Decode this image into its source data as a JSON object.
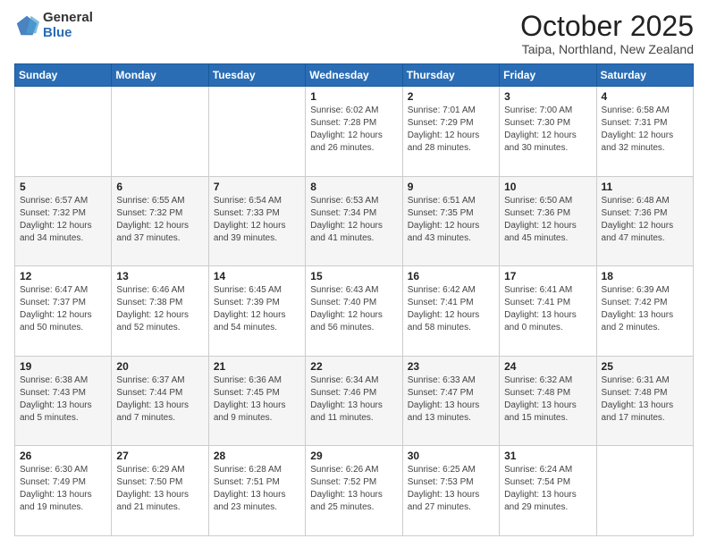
{
  "logo": {
    "general": "General",
    "blue": "Blue"
  },
  "title": {
    "month": "October 2025",
    "location": "Taipa, Northland, New Zealand"
  },
  "days_header": [
    "Sunday",
    "Monday",
    "Tuesday",
    "Wednesday",
    "Thursday",
    "Friday",
    "Saturday"
  ],
  "weeks": [
    [
      null,
      null,
      null,
      {
        "day": 1,
        "sunrise": "6:02 AM",
        "sunset": "7:28 PM",
        "daylight": "12 hours and 26 minutes."
      },
      {
        "day": 2,
        "sunrise": "7:01 AM",
        "sunset": "7:29 PM",
        "daylight": "12 hours and 28 minutes."
      },
      {
        "day": 3,
        "sunrise": "7:00 AM",
        "sunset": "7:30 PM",
        "daylight": "12 hours and 30 minutes."
      },
      {
        "day": 4,
        "sunrise": "6:58 AM",
        "sunset": "7:31 PM",
        "daylight": "12 hours and 32 minutes."
      }
    ],
    [
      {
        "day": 5,
        "sunrise": "6:57 AM",
        "sunset": "7:32 PM",
        "daylight": "12 hours and 34 minutes."
      },
      {
        "day": 6,
        "sunrise": "6:55 AM",
        "sunset": "7:32 PM",
        "daylight": "12 hours and 37 minutes."
      },
      {
        "day": 7,
        "sunrise": "6:54 AM",
        "sunset": "7:33 PM",
        "daylight": "12 hours and 39 minutes."
      },
      {
        "day": 8,
        "sunrise": "6:53 AM",
        "sunset": "7:34 PM",
        "daylight": "12 hours and 41 minutes."
      },
      {
        "day": 9,
        "sunrise": "6:51 AM",
        "sunset": "7:35 PM",
        "daylight": "12 hours and 43 minutes."
      },
      {
        "day": 10,
        "sunrise": "6:50 AM",
        "sunset": "7:36 PM",
        "daylight": "12 hours and 45 minutes."
      },
      {
        "day": 11,
        "sunrise": "6:48 AM",
        "sunset": "7:36 PM",
        "daylight": "12 hours and 47 minutes."
      }
    ],
    [
      {
        "day": 12,
        "sunrise": "6:47 AM",
        "sunset": "7:37 PM",
        "daylight": "12 hours and 50 minutes."
      },
      {
        "day": 13,
        "sunrise": "6:46 AM",
        "sunset": "7:38 PM",
        "daylight": "12 hours and 52 minutes."
      },
      {
        "day": 14,
        "sunrise": "6:45 AM",
        "sunset": "7:39 PM",
        "daylight": "12 hours and 54 minutes."
      },
      {
        "day": 15,
        "sunrise": "6:43 AM",
        "sunset": "7:40 PM",
        "daylight": "12 hours and 56 minutes."
      },
      {
        "day": 16,
        "sunrise": "6:42 AM",
        "sunset": "7:41 PM",
        "daylight": "12 hours and 58 minutes."
      },
      {
        "day": 17,
        "sunrise": "6:41 AM",
        "sunset": "7:41 PM",
        "daylight": "13 hours and 0 minutes."
      },
      {
        "day": 18,
        "sunrise": "6:39 AM",
        "sunset": "7:42 PM",
        "daylight": "13 hours and 2 minutes."
      }
    ],
    [
      {
        "day": 19,
        "sunrise": "6:38 AM",
        "sunset": "7:43 PM",
        "daylight": "13 hours and 5 minutes."
      },
      {
        "day": 20,
        "sunrise": "6:37 AM",
        "sunset": "7:44 PM",
        "daylight": "13 hours and 7 minutes."
      },
      {
        "day": 21,
        "sunrise": "6:36 AM",
        "sunset": "7:45 PM",
        "daylight": "13 hours and 9 minutes."
      },
      {
        "day": 22,
        "sunrise": "6:34 AM",
        "sunset": "7:46 PM",
        "daylight": "13 hours and 11 minutes."
      },
      {
        "day": 23,
        "sunrise": "6:33 AM",
        "sunset": "7:47 PM",
        "daylight": "13 hours and 13 minutes."
      },
      {
        "day": 24,
        "sunrise": "6:32 AM",
        "sunset": "7:48 PM",
        "daylight": "13 hours and 15 minutes."
      },
      {
        "day": 25,
        "sunrise": "6:31 AM",
        "sunset": "7:48 PM",
        "daylight": "13 hours and 17 minutes."
      }
    ],
    [
      {
        "day": 26,
        "sunrise": "6:30 AM",
        "sunset": "7:49 PM",
        "daylight": "13 hours and 19 minutes."
      },
      {
        "day": 27,
        "sunrise": "6:29 AM",
        "sunset": "7:50 PM",
        "daylight": "13 hours and 21 minutes."
      },
      {
        "day": 28,
        "sunrise": "6:28 AM",
        "sunset": "7:51 PM",
        "daylight": "13 hours and 23 minutes."
      },
      {
        "day": 29,
        "sunrise": "6:26 AM",
        "sunset": "7:52 PM",
        "daylight": "13 hours and 25 minutes."
      },
      {
        "day": 30,
        "sunrise": "6:25 AM",
        "sunset": "7:53 PM",
        "daylight": "13 hours and 27 minutes."
      },
      {
        "day": 31,
        "sunrise": "6:24 AM",
        "sunset": "7:54 PM",
        "daylight": "13 hours and 29 minutes."
      },
      null
    ]
  ]
}
